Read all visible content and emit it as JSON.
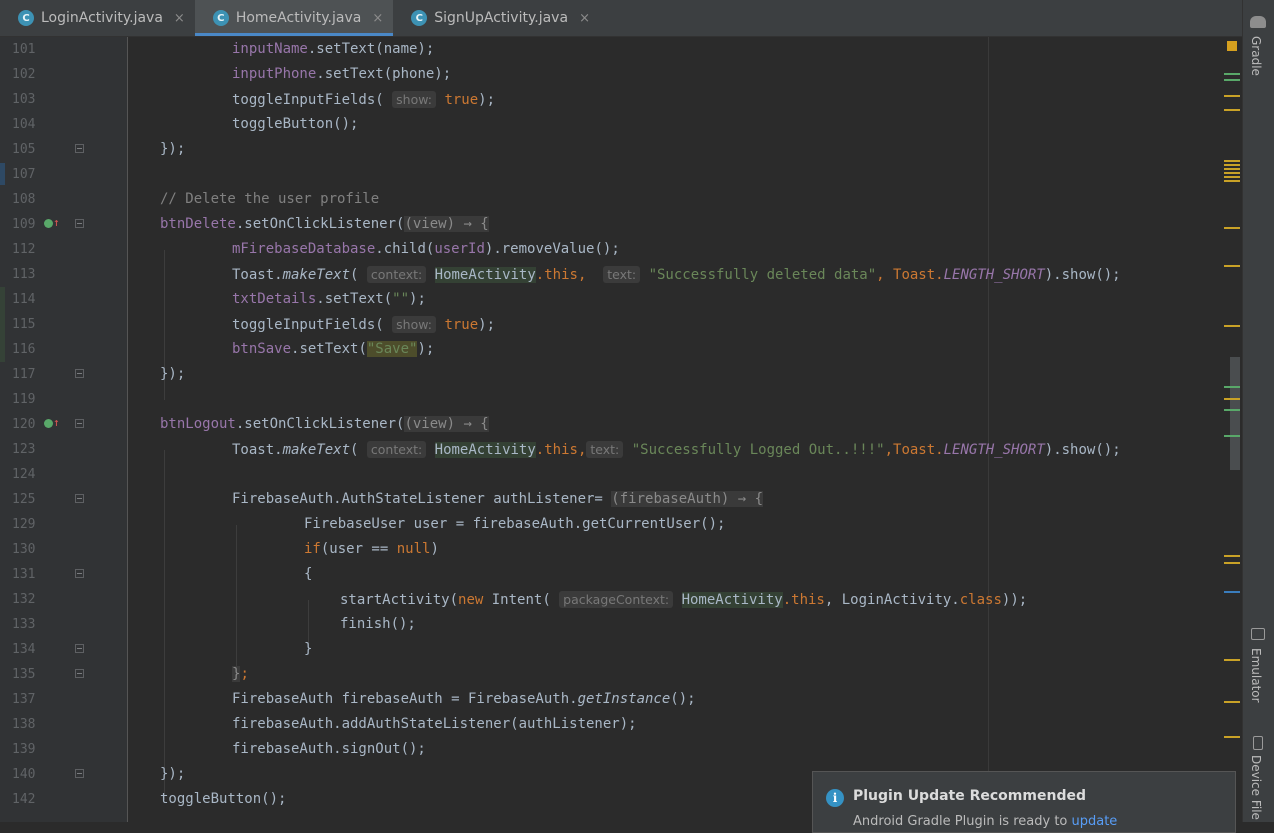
{
  "tabs": [
    {
      "label": "LoginActivity.java",
      "icon": "C"
    },
    {
      "label": "HomeActivity.java",
      "icon": "C"
    },
    {
      "label": "SignUpActivity.java",
      "icon": "C"
    }
  ],
  "tab_close_glyph": "×",
  "right_sidebar": {
    "gradle": "Gradle",
    "emulator": "Emulator",
    "device_file": "Device File"
  },
  "notification": {
    "title": "Plugin Update Recommended",
    "body": "Android Gradle Plugin is ready to ",
    "link": "update"
  },
  "lines": {
    "l101": {
      "num": "101",
      "a": "inputName",
      "b": ".setText(name);"
    },
    "l102": {
      "num": "102",
      "a": "inputPhone",
      "b": ".setText(phone);"
    },
    "l103": {
      "num": "103",
      "a": "toggleInputFields( ",
      "hint": "show:",
      "kw": "true",
      "b": ");"
    },
    "l104": {
      "num": "104",
      "a": "toggleButton();"
    },
    "l105": {
      "num": "105",
      "a": "});"
    },
    "l107": {
      "num": "107"
    },
    "l108": {
      "num": "108",
      "a": "// Delete the user profile"
    },
    "l109": {
      "num": "109",
      "a": "btnDelete",
      "b": ".setOnClickListener(",
      "lambda": "(view) → {"
    },
    "l112": {
      "num": "112",
      "a": "mFirebaseDatabase",
      "b": ".child(",
      "c": "userId",
      "d": ").removeValue();"
    },
    "l113": {
      "num": "113",
      "a": "Toast.",
      "b": "makeText",
      "c": "( ",
      "h1": "context:",
      "d": "HomeActivity",
      "e": ".this",
      "f": ",  ",
      "h2": "text:",
      "g": "\"Successfully deleted data\"",
      "i": ", Toast.",
      "j": "LENGTH_SHORT",
      "k": ").show();"
    },
    "l114": {
      "num": "114",
      "a": "txtDetails",
      "b": ".setText(",
      "s": "\"\"",
      "c": ");"
    },
    "l115": {
      "num": "115",
      "a": "toggleInputFields( ",
      "hint": "show:",
      "kw": "true",
      "b": ");"
    },
    "l116": {
      "num": "116",
      "a": "btnSave",
      "b": ".setText(",
      "s": "\"Save\"",
      "c": ");"
    },
    "l117": {
      "num": "117",
      "a": "});"
    },
    "l119": {
      "num": "119"
    },
    "l120": {
      "num": "120",
      "a": "btnLogout",
      "b": ".setOnClickListener(",
      "lambda": "(view) → {"
    },
    "l123": {
      "num": "123",
      "a": "Toast.",
      "b": "makeText",
      "c": "( ",
      "h1": "context:",
      "d": "HomeActivity",
      "e": ".this",
      "f": ",",
      "h2": "text:",
      "g": "\"Successfully Logged Out..!!!\"",
      "i": ",Toast.",
      "j": "LENGTH_SHORT",
      "k": ").show();"
    },
    "l124": {
      "num": "124"
    },
    "l125": {
      "num": "125",
      "a": "FirebaseAuth.AuthStateListener authListener= ",
      "lambda": "(firebaseAuth) → {"
    },
    "l129": {
      "num": "129",
      "a": "FirebaseUser user = firebaseAuth.getCurrentUser();"
    },
    "l130": {
      "num": "130",
      "kw": "if",
      "a": "(user == ",
      "kw2": "null",
      "b": ")"
    },
    "l131": {
      "num": "131",
      "a": "{"
    },
    "l132": {
      "num": "132",
      "a": "startActivity(",
      "kw": "new",
      "b": " Intent( ",
      "hint": "packageContext:",
      "c": "HomeActivity",
      "d": ".this",
      "e": ", LoginActivity.",
      "f": "class",
      "g": "));"
    },
    "l133": {
      "num": "133",
      "a": "finish();"
    },
    "l134": {
      "num": "134",
      "a": "}"
    },
    "l135": {
      "num": "135",
      "a": "}",
      "b": ";"
    },
    "l137": {
      "num": "137",
      "a": "FirebaseAuth firebaseAuth = FirebaseAuth.",
      "b": "getInstance",
      "c": "();"
    },
    "l138": {
      "num": "138",
      "a": "firebaseAuth.addAuthStateListener(authListener);"
    },
    "l139": {
      "num": "139",
      "a": "firebaseAuth.signOut();"
    },
    "l140": {
      "num": "140",
      "a": "});"
    },
    "l142": {
      "num": "142",
      "a": "toggleButton();"
    }
  }
}
